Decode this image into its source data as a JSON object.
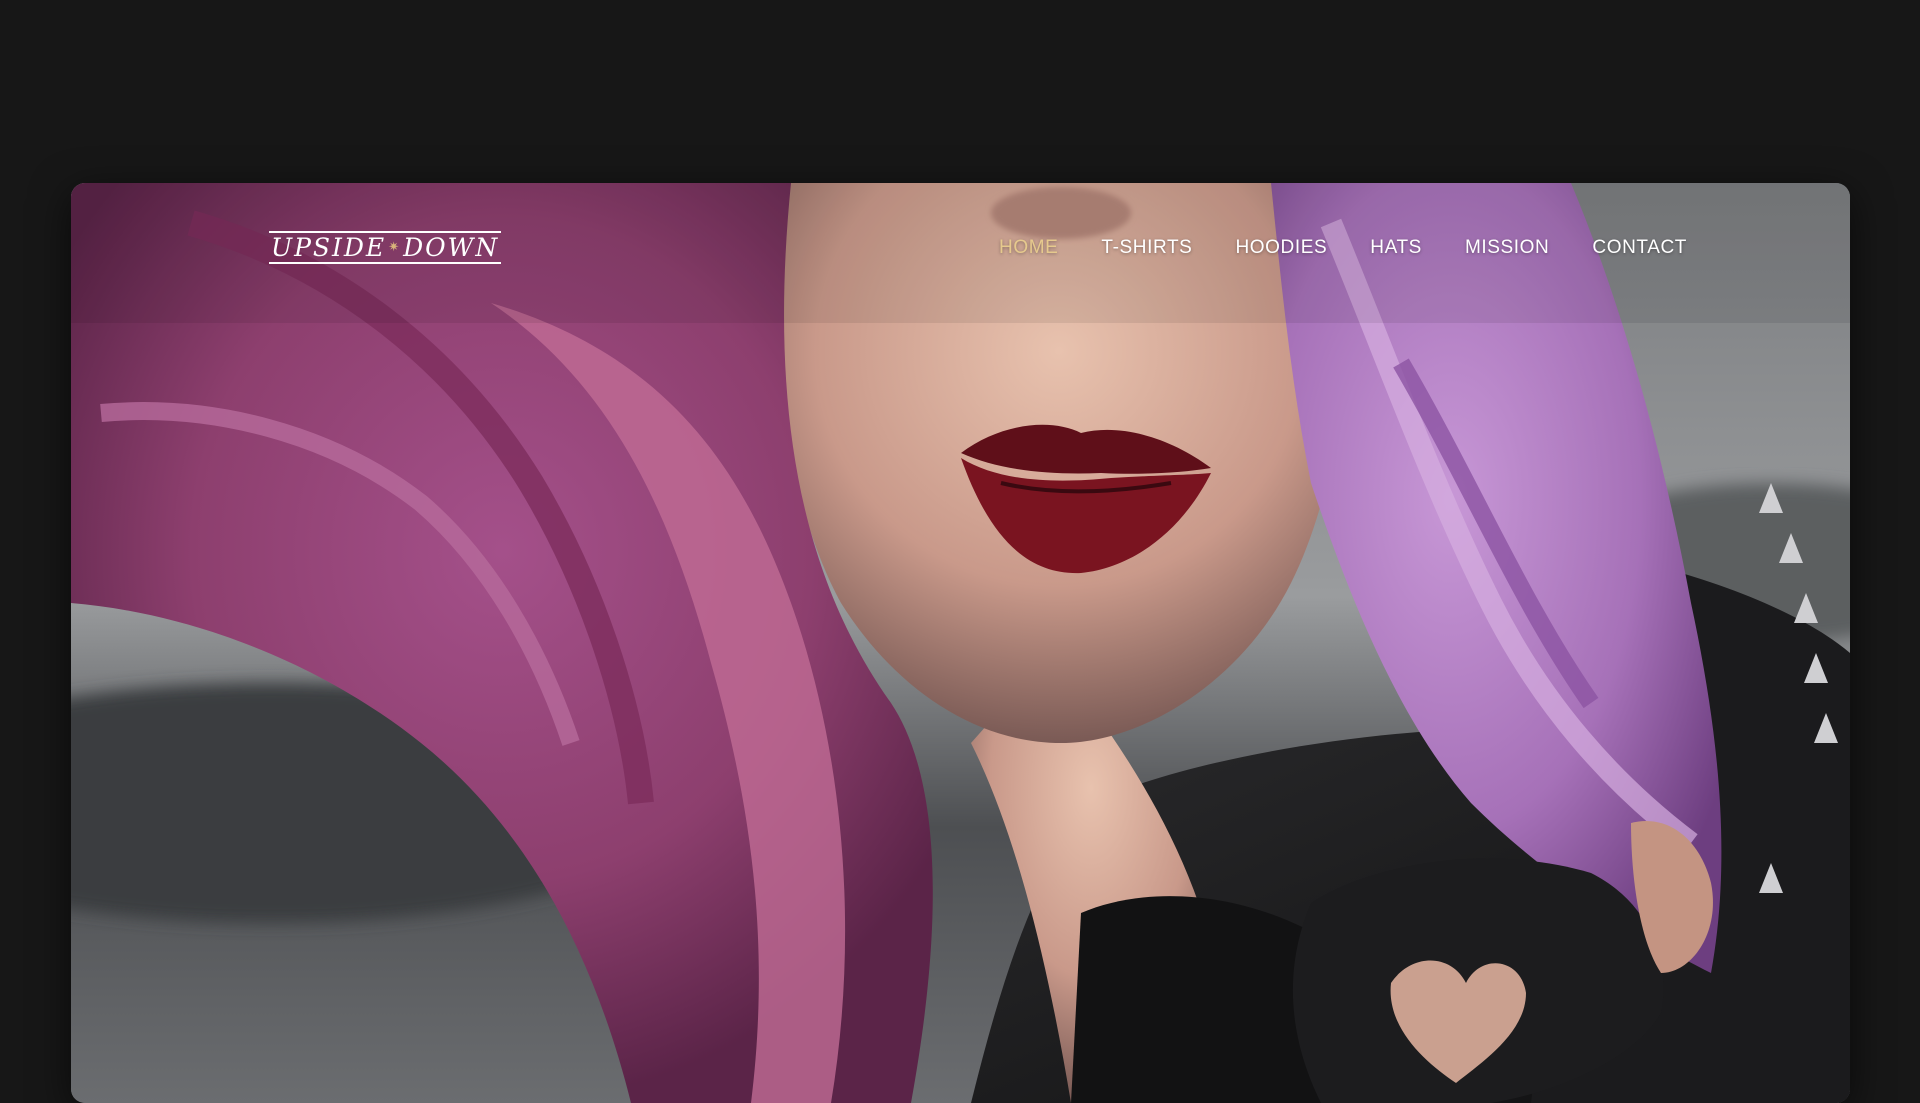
{
  "brand": {
    "logo_left": "UPSIDE",
    "logo_separator": "✷",
    "logo_right": "DOWN"
  },
  "nav": {
    "items": [
      {
        "label": "HOME",
        "active": true
      },
      {
        "label": "T-SHIRTS",
        "active": false
      },
      {
        "label": "HOODIES",
        "active": false
      },
      {
        "label": "HATS",
        "active": false
      },
      {
        "label": "MISSION",
        "active": false
      },
      {
        "label": "CONTACT",
        "active": false
      }
    ]
  },
  "colors": {
    "page_background": "#171717",
    "nav_text": "#ffffff",
    "nav_active": "#e6c98d",
    "hair_purple": "#b07ac4",
    "hair_pink": "#c45a8a",
    "lips": "#7a1420",
    "jacket": "#1d1d1f"
  },
  "hero": {
    "image": "photo-woman-purple-hair-leather-jacket"
  }
}
